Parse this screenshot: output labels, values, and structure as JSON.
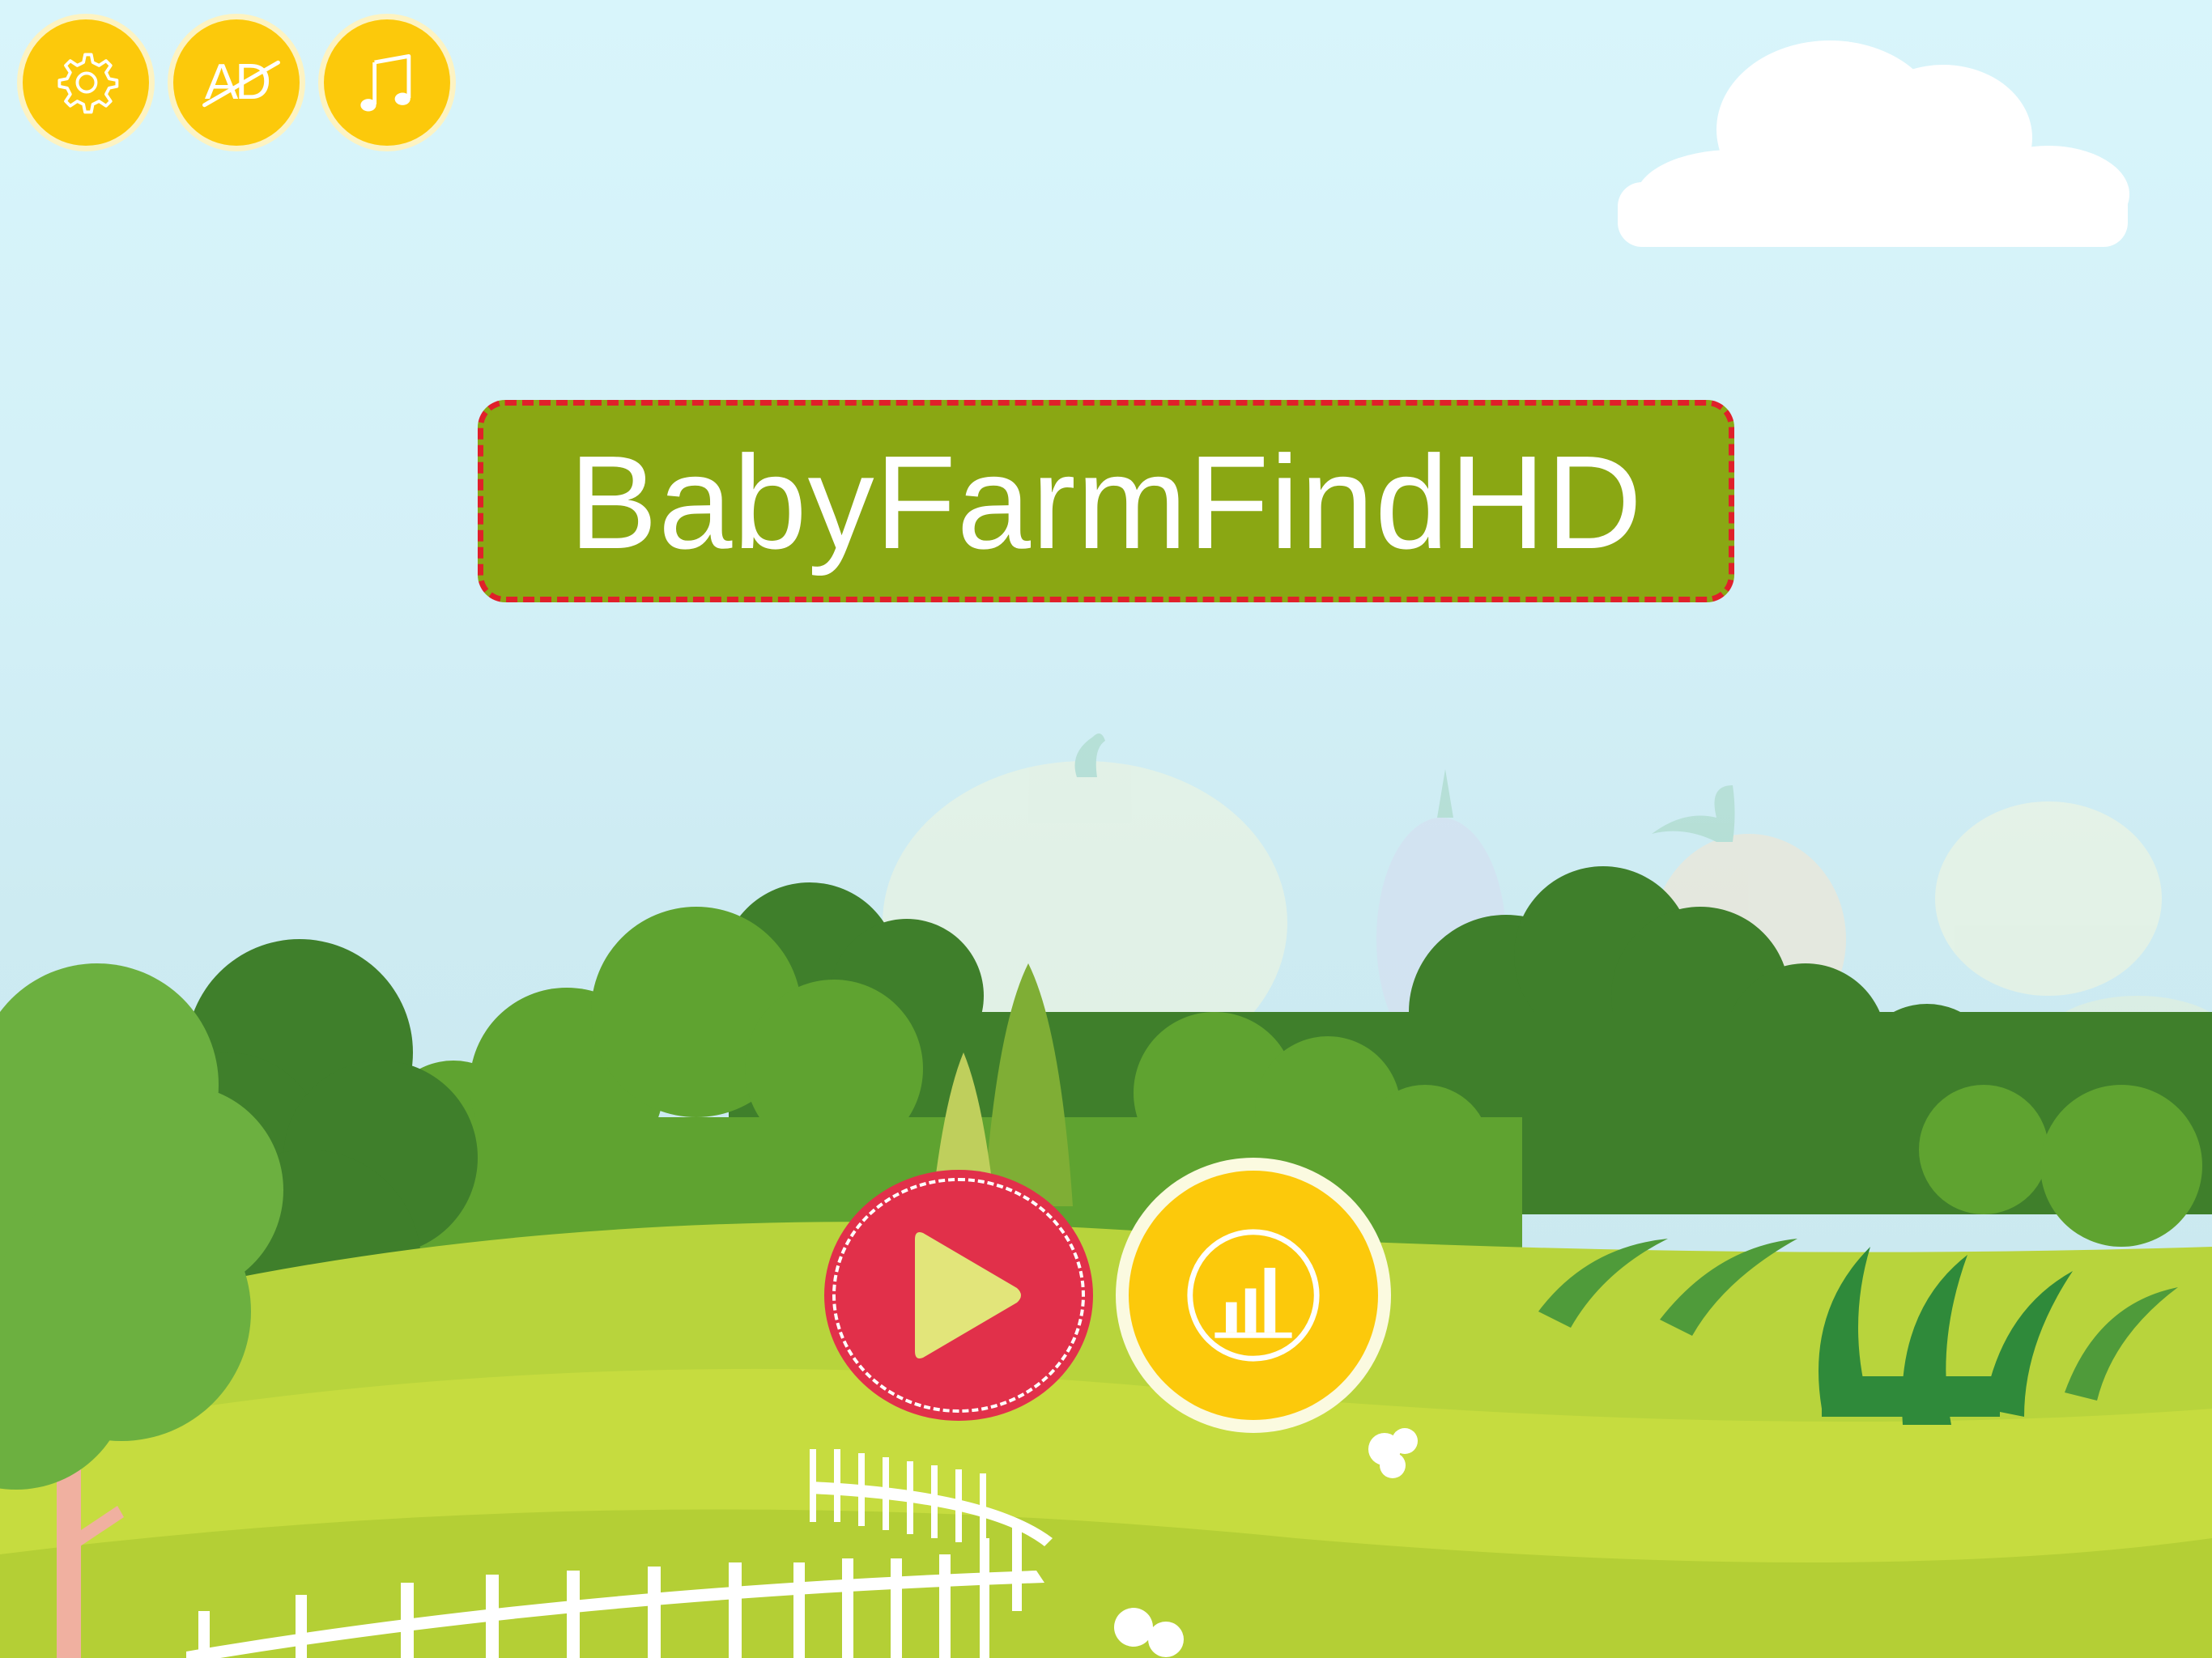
{
  "toolbar": {
    "settings_icon": "gear-icon",
    "noads_label": "AD",
    "noads_icon": "no-ads-icon",
    "music_icon": "music-note-icon"
  },
  "title": {
    "text": "BabyFarmFindHD"
  },
  "actions": {
    "play_icon": "play-icon",
    "leaderboard_icon": "bar-chart-icon"
  },
  "colors": {
    "sky": "#d8f5fb",
    "toolbar_yellow": "#fcc90b",
    "title_green": "#8aa713",
    "title_border_red": "#e0202a",
    "play_red": "#e1304a",
    "play_triangle": "#e2e57a",
    "grass_light": "#c6dc3f",
    "tree_green": "#5fa330",
    "tree_dark": "#3f7f2b"
  }
}
